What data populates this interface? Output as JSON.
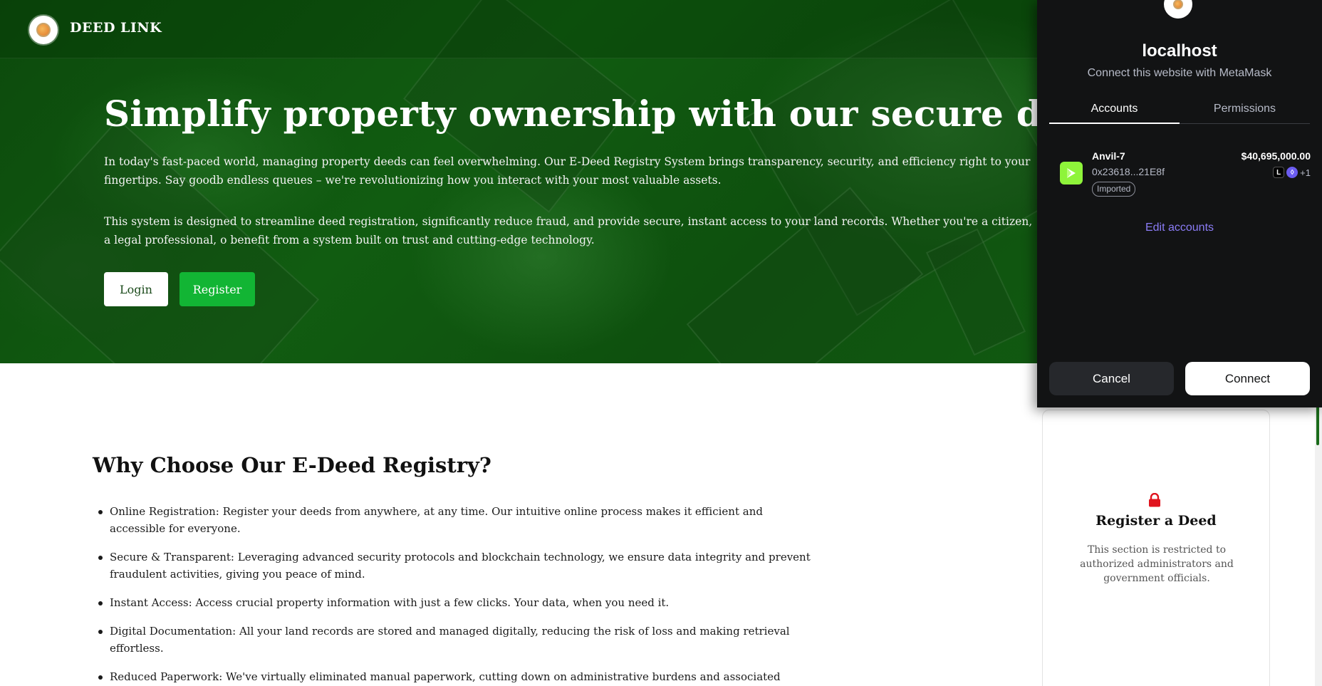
{
  "site": {
    "brand": "DEED LINK",
    "hero": {
      "title": "Simplify property ownership with our secure digital deed re",
      "paragraph1": "In today's fast-paced world, managing property deeds can feel overwhelming. Our E-Deed Registry System brings transparency, security, and efficiency right to your fingertips. Say goodb endless queues – we're revolutionizing how you interact with your most valuable assets.",
      "paragraph2": "This system is designed to streamline deed registration, significantly reduce fraud, and provide secure, instant access to your land records. Whether you're a citizen, a legal professional, o benefit from a system built on trust and cutting-edge technology.",
      "login_label": "Login",
      "register_label": "Register"
    },
    "why": {
      "title": "Why Choose Our E-Deed Registry?",
      "items": [
        "Online Registration: Register your deeds from anywhere, at any time. Our intuitive online process makes it efficient and accessible for everyone.",
        "Secure & Transparent: Leveraging advanced security protocols and blockchain technology, we ensure data integrity and prevent fraudulent activities, giving you peace of mind.",
        "Instant Access: Access crucial property information with just a few clicks. Your data, when you need it.",
        "Digital Documentation: All your land records are stored and managed digitally, reducing the risk of loss and making retrieval effortless.",
        "Reduced Paperwork: We've virtually eliminated manual paperwork, cutting down on administrative burdens and associated delays."
      ]
    },
    "register_card": {
      "title": "Register a Deed",
      "text": "This section is restricted to authorized administrators and government officials."
    }
  },
  "metamask": {
    "host": "localhost",
    "subtitle": "Connect this website with MetaMask",
    "tabs": [
      "Accounts",
      "Permissions"
    ],
    "account": {
      "name": "Anvil-7",
      "address": "0x23618...21E8f",
      "badge": "Imported",
      "balance": "$40,695,000.00",
      "token_a": "L",
      "token_b": "◊",
      "more_tokens": "+1"
    },
    "edit_label": "Edit accounts",
    "cancel_label": "Cancel",
    "connect_label": "Connect"
  },
  "colors": {
    "hero_green": "#115c11",
    "register_green": "#12b534",
    "metamask_bg": "#121314",
    "metamask_link": "#8b7cf6",
    "lock_red": "#e0141e"
  }
}
